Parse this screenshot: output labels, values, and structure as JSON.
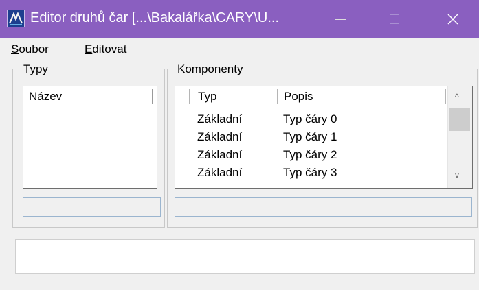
{
  "window": {
    "title": "Editor druhů čar [...\\Bakalářka\\CARY\\U...",
    "title_bar_color": "#8a5fc0",
    "icon": "app-logo-icon",
    "controls": {
      "minimize": "minimize-icon",
      "maximize": "maximize-icon",
      "close_glyph": "✕"
    }
  },
  "menu": {
    "soubor": {
      "mnemonic": "S",
      "rest": "oubor"
    },
    "editovat": {
      "mnemonic": "E",
      "rest": "ditovat"
    }
  },
  "types_group": {
    "label": "Typy",
    "column_header": "Název",
    "rows": []
  },
  "components_group": {
    "label": "Komponenty",
    "columns": [
      "Typ",
      "Popis"
    ],
    "rows": [
      {
        "typ": "Základní",
        "popis": "Typ čáry 0"
      },
      {
        "typ": "Základní",
        "popis": "Typ čáry 1"
      },
      {
        "typ": "Základní",
        "popis": "Typ čáry 2"
      },
      {
        "typ": "Základní",
        "popis": "Typ čáry 3"
      }
    ],
    "scrollbar": {
      "up_glyph": "^",
      "down_glyph": "v"
    }
  },
  "status": {
    "left_value": "",
    "right_value": "",
    "message": ""
  }
}
